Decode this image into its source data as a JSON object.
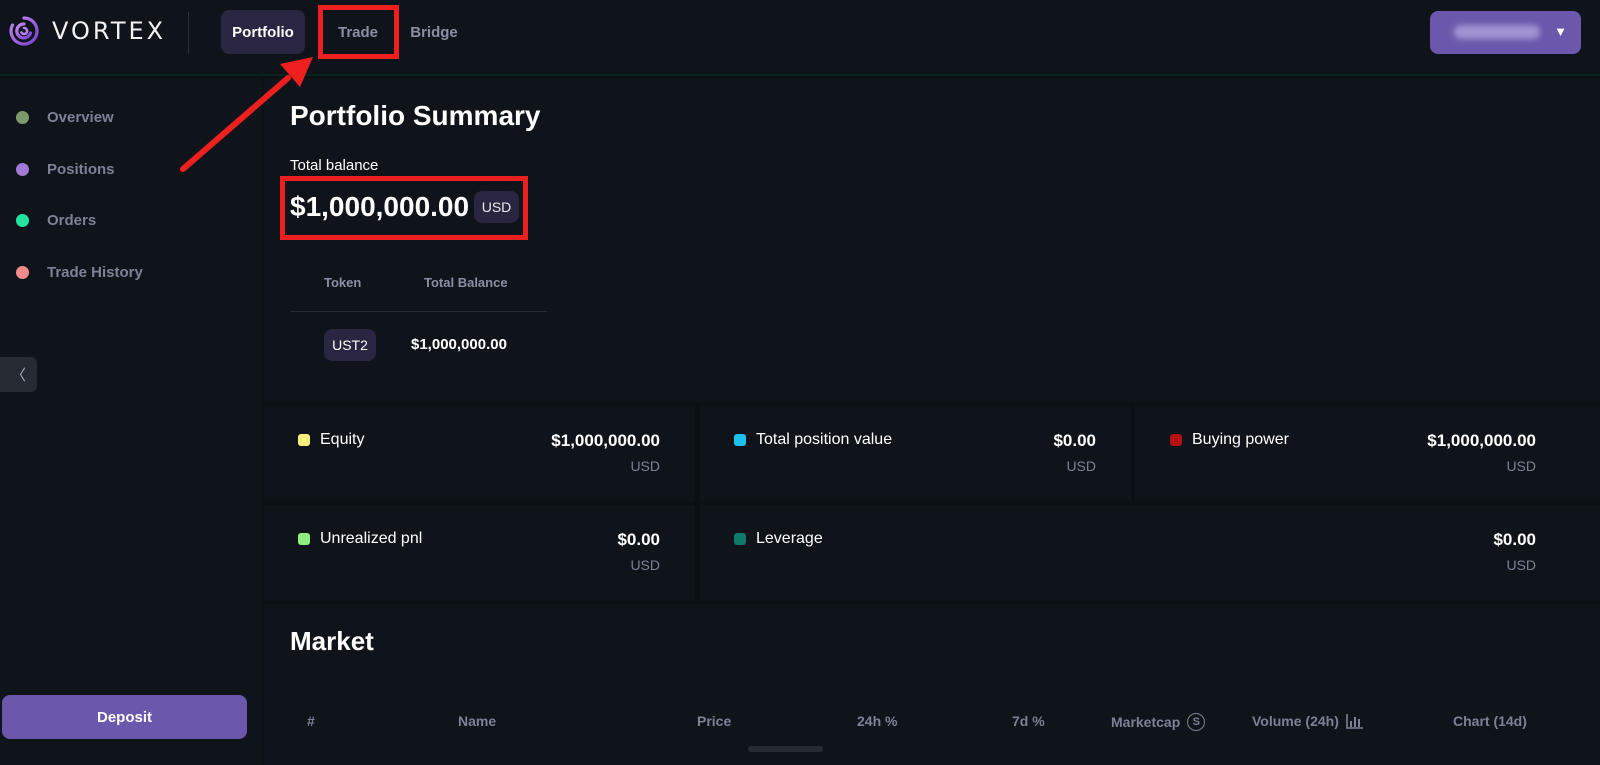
{
  "app": {
    "brand": "VORTEX"
  },
  "nav": {
    "tabs": [
      {
        "label": "Portfolio",
        "active": true
      },
      {
        "label": "Trade",
        "active": false
      },
      {
        "label": "Bridge",
        "active": false
      }
    ]
  },
  "sidebar": {
    "items": [
      {
        "label": "Overview",
        "color": "#7d9a6b"
      },
      {
        "label": "Positions",
        "color": "#a07ad4"
      },
      {
        "label": "Orders",
        "color": "#23e3a0"
      },
      {
        "label": "Trade History",
        "color": "#f08b8b"
      }
    ],
    "deposit_label": "Deposit"
  },
  "summary": {
    "title": "Portfolio Summary",
    "balance_label": "Total balance",
    "balance_value": "$1,000,000.00",
    "currency": "USD",
    "table": {
      "headers": [
        "Token",
        "Total Balance"
      ],
      "rows": [
        {
          "token": "UST2",
          "balance": "$1,000,000.00"
        }
      ]
    }
  },
  "stats": [
    {
      "label": "Equity",
      "value": "$1,000,000.00",
      "unit": "USD",
      "color": "#f5ec7c"
    },
    {
      "label": "Total position value",
      "value": "$0.00",
      "unit": "USD",
      "color": "#1ec0f2"
    },
    {
      "label": "Buying power",
      "value": "$1,000,000.00",
      "unit": "USD",
      "color": "#b51014"
    },
    {
      "label": "Unrealized pnl",
      "value": "$0.00",
      "unit": "USD",
      "color": "#8ef07c"
    },
    {
      "label": "Leverage",
      "value": "$0.00",
      "unit": "USD",
      "color": "#0f7a6a"
    }
  ],
  "market": {
    "title": "Market",
    "headers": [
      "#",
      "Name",
      "Price",
      "24h %",
      "7d %",
      "Marketcap",
      "Volume (24h)",
      "Chart (14d)"
    ],
    "marketcap_icon_glyph": "S"
  },
  "annotation_color": "#ee1f1f",
  "colors": {
    "accent": "#6b58ad",
    "background": "#0b1015",
    "panel": "#0f141b"
  }
}
